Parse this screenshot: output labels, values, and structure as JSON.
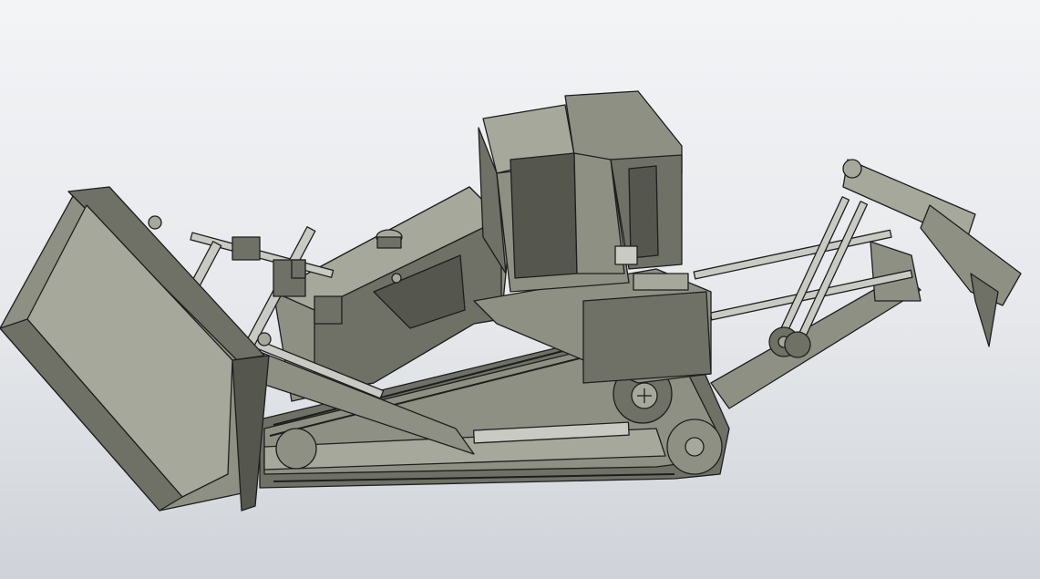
{
  "model": {
    "label": "",
    "colors": {
      "background_top": "#f3f4f6",
      "background_bottom": "#cfd3d9",
      "body": "#8f9084",
      "body_light": "#a7a89c",
      "body_dark": "#6f7066",
      "rods": "#c9cac4",
      "edges": "#1e1e1e"
    }
  }
}
